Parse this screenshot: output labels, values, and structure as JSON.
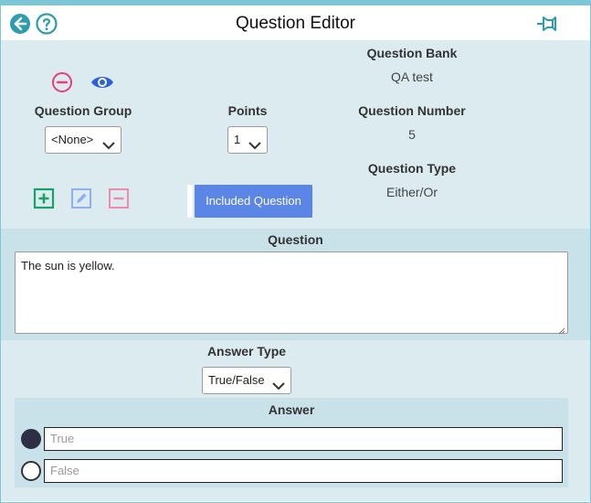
{
  "header": {
    "title": "Question Editor",
    "back_icon": "arrow-left-circle-icon",
    "help_icon": "question-circle-icon",
    "pin_icon": "pin-icon"
  },
  "info": {
    "question_bank_label": "Question Bank",
    "question_bank_value": "QA test",
    "question_number_label": "Question Number",
    "question_number_value": "5",
    "question_type_label": "Question Type",
    "question_type_value": "Either/Or"
  },
  "question_group": {
    "label": "Question Group",
    "selected": "<None>"
  },
  "points": {
    "label": "Points",
    "selected": "1"
  },
  "actions": {
    "remove_icon": "minus-circle-icon",
    "preview_icon": "eye-icon",
    "add_icon": "plus-square-icon",
    "edit_icon": "pencil-square-icon",
    "delete_icon": "minus-square-icon",
    "included_label": "Included Question"
  },
  "question": {
    "label": "Question",
    "text": "The sun is yellow."
  },
  "answer_type": {
    "label": "Answer Type",
    "selected": "True/False"
  },
  "answer": {
    "title": "Answer",
    "options": [
      {
        "placeholder": "True",
        "selected": true
      },
      {
        "placeholder": "False",
        "selected": false
      }
    ]
  },
  "colors": {
    "accent_teal": "#2a9db3",
    "panel_light": "#dbebef",
    "panel_dark": "#c9e2e9",
    "button_blue": "#5b86e5",
    "pink": "#e83e7a",
    "eye_blue": "#2d5fd6",
    "green": "#16a36a"
  }
}
